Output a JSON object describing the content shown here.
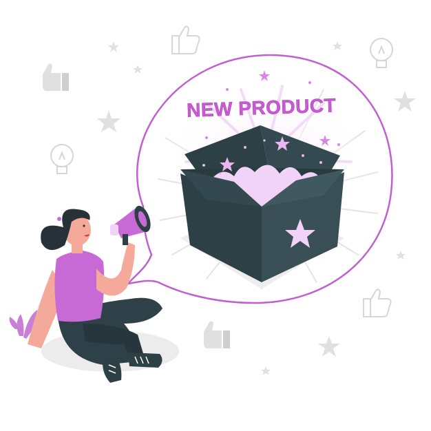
{
  "headline": "NEW PRODUCT",
  "colors": {
    "accent_purple": "#c05fcf",
    "headline_fill": "#c85ad4",
    "box_dark": "#2d4046",
    "box_mid": "#3a4f55",
    "skin": "#f5a99a",
    "hair": "#263238",
    "pants": "#2f4148",
    "gray_icons": "#e0e0e0",
    "glow": "#f2d9f7"
  },
  "icons": [
    "thumbs-up-icon",
    "lightbulb-icon",
    "star-icon",
    "megaphone-icon",
    "plant-icon"
  ]
}
